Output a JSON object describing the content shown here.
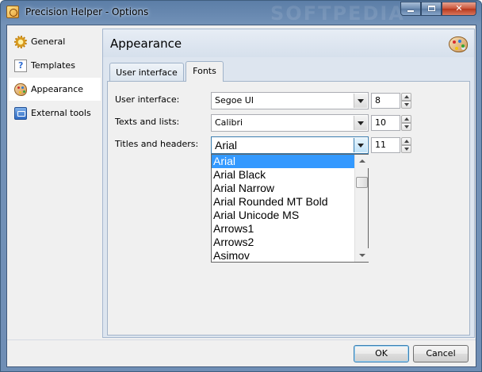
{
  "window": {
    "title": "Precision Helper - Options",
    "watermark": "SOFTPEDIA"
  },
  "sidebar": {
    "items": [
      {
        "label": "General",
        "icon": "gear-icon"
      },
      {
        "label": "Templates",
        "icon": "template-icon"
      },
      {
        "label": "Appearance",
        "icon": "palette-icon"
      },
      {
        "label": "External tools",
        "icon": "tools-icon"
      }
    ],
    "selected": "Appearance"
  },
  "panel": {
    "title": "Appearance",
    "tabs": [
      {
        "label": "User interface"
      },
      {
        "label": "Fonts"
      }
    ],
    "active_tab": "Fonts"
  },
  "fonts": {
    "user_interface": {
      "label": "User interface:",
      "font": "Segoe UI",
      "size": "8"
    },
    "texts_lists": {
      "label": "Texts and lists:",
      "font": "Calibri",
      "size": "10"
    },
    "titles_headers": {
      "label": "Titles and headers:",
      "font": "Arial",
      "size": "11"
    }
  },
  "dropdown": {
    "options": [
      "Arial",
      "Arial Black",
      "Arial Narrow",
      "Arial Rounded MT Bold",
      "Arial Unicode MS",
      "Arrows1",
      "Arrows2",
      "Asimov"
    ],
    "selected": "Arial"
  },
  "buttons": {
    "ok": "OK",
    "cancel": "Cancel"
  },
  "colors": {
    "selection": "#3399ff",
    "titlebar": "#6d8db4",
    "panel": "#dde5ef"
  }
}
